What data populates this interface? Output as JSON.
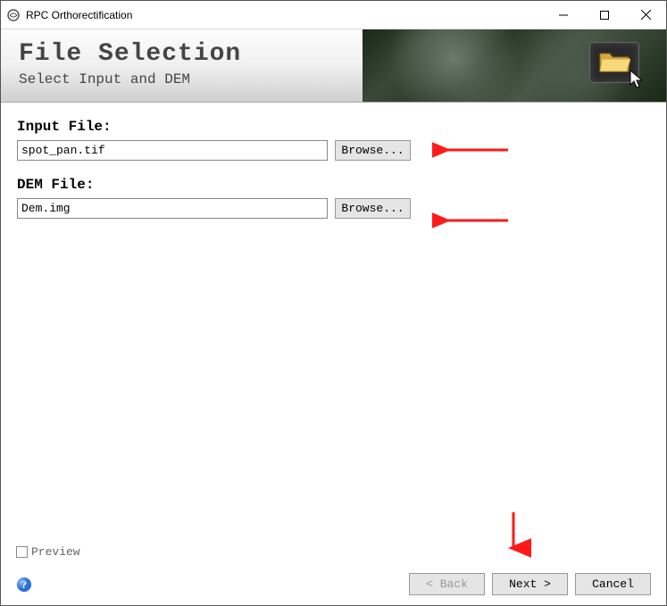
{
  "window": {
    "title": "RPC Orthorectification"
  },
  "banner": {
    "title": "File Selection",
    "subtitle": "Select Input and DEM"
  },
  "fields": {
    "input": {
      "label": "Input File:",
      "value": "spot_pan.tif",
      "browse": "Browse..."
    },
    "dem": {
      "label": "DEM File:",
      "value": "Dem.img",
      "browse": "Browse..."
    }
  },
  "preview": {
    "label": "Preview",
    "checked": false
  },
  "footer": {
    "back": "< Back",
    "next": "Next >",
    "cancel": "Cancel"
  }
}
